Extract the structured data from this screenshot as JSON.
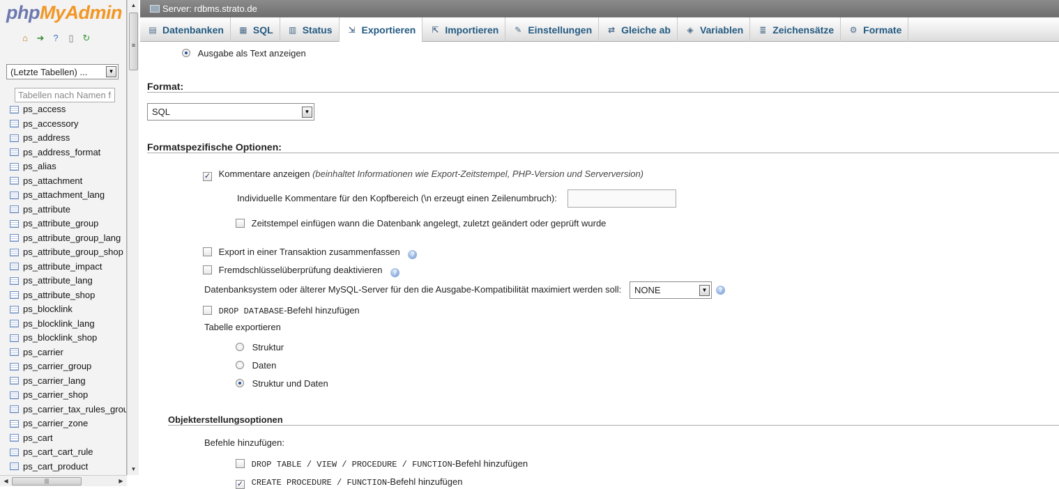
{
  "sidebar": {
    "logo_part1": "php",
    "logo_part2": "MyAdmin",
    "quicklinks": [
      "home-icon",
      "exit-icon",
      "help-icon",
      "docs-icon",
      "reload-icon"
    ],
    "db_select_value": "(Letzte Tabellen) ...",
    "filter_placeholder": "Tabellen nach Namen fi",
    "tables": [
      "ps_access",
      "ps_accessory",
      "ps_address",
      "ps_address_format",
      "ps_alias",
      "ps_attachment",
      "ps_attachment_lang",
      "ps_attribute",
      "ps_attribute_group",
      "ps_attribute_group_lang",
      "ps_attribute_group_shop",
      "ps_attribute_impact",
      "ps_attribute_lang",
      "ps_attribute_shop",
      "ps_blocklink",
      "ps_blocklink_lang",
      "ps_blocklink_shop",
      "ps_carrier",
      "ps_carrier_group",
      "ps_carrier_lang",
      "ps_carrier_shop",
      "ps_carrier_tax_rules_grou",
      "ps_carrier_zone",
      "ps_cart",
      "ps_cart_cart_rule",
      "ps_cart_product"
    ]
  },
  "header": {
    "server_label": "Server: rdbms.strato.de",
    "tabs": [
      {
        "label": "Datenbanken",
        "icon": "database-icon",
        "active": false
      },
      {
        "label": "SQL",
        "icon": "sql-icon",
        "active": false
      },
      {
        "label": "Status",
        "icon": "status-icon",
        "active": false
      },
      {
        "label": "Exportieren",
        "icon": "export-icon",
        "active": true
      },
      {
        "label": "Importieren",
        "icon": "import-icon",
        "active": false
      },
      {
        "label": "Einstellungen",
        "icon": "wrench-icon",
        "active": false
      },
      {
        "label": "Gleiche ab",
        "icon": "sync-icon",
        "active": false
      },
      {
        "label": "Variablen",
        "icon": "variables-icon",
        "active": false
      },
      {
        "label": "Zeichensätze",
        "icon": "charset-icon",
        "active": false
      },
      {
        "label": "Formate",
        "icon": "formats-icon",
        "active": false
      }
    ]
  },
  "main": {
    "output_as_text": "Ausgabe als Text anzeigen",
    "format_title": "Format:",
    "format_value": "SQL",
    "format_options_title": "Formatspezifische Optionen:",
    "comments_label": "Kommentare anzeigen",
    "comments_note": "(beinhaltet Informationen wie Export-Zeitstempel, PHP-Version und Serverversion)",
    "custom_comments_label": "Individuelle Kommentare für den Kopfbereich (\\n erzeugt einen Zeilenumbruch):",
    "custom_comments_value": "",
    "timestamp_label": "Zeitstempel einfügen wann die Datenbank angelegt, zuletzt geändert oder geprüft wurde",
    "transaction_label": "Export in einer Transaktion zusammenfassen",
    "fk_label": "Fremdschlüsselüberprüfung deaktivieren",
    "compat_label": "Datenbanksystem oder älterer MySQL-Server für den die Ausgabe-Kompatibilität maximiert werden soll:",
    "compat_value": "NONE",
    "drop_db_code": "DROP DATABASE",
    "drop_db_suffix": "-Befehl hinzufügen",
    "table_export_label": "Tabelle exportieren",
    "table_export_options": [
      "Struktur",
      "Daten",
      "Struktur und Daten"
    ],
    "object_options_title": "Objekterstellungsoptionen",
    "add_commands_label": "Befehle hinzufügen:",
    "drop_table_code": "DROP TABLE / VIEW / PROCEDURE / FUNCTION",
    "drop_table_suffix": "-Befehl hinzufügen",
    "create_proc_code": "CREATE PROCEDURE / FUNCTION",
    "create_proc_suffix": "-Befehl hinzufügen"
  }
}
